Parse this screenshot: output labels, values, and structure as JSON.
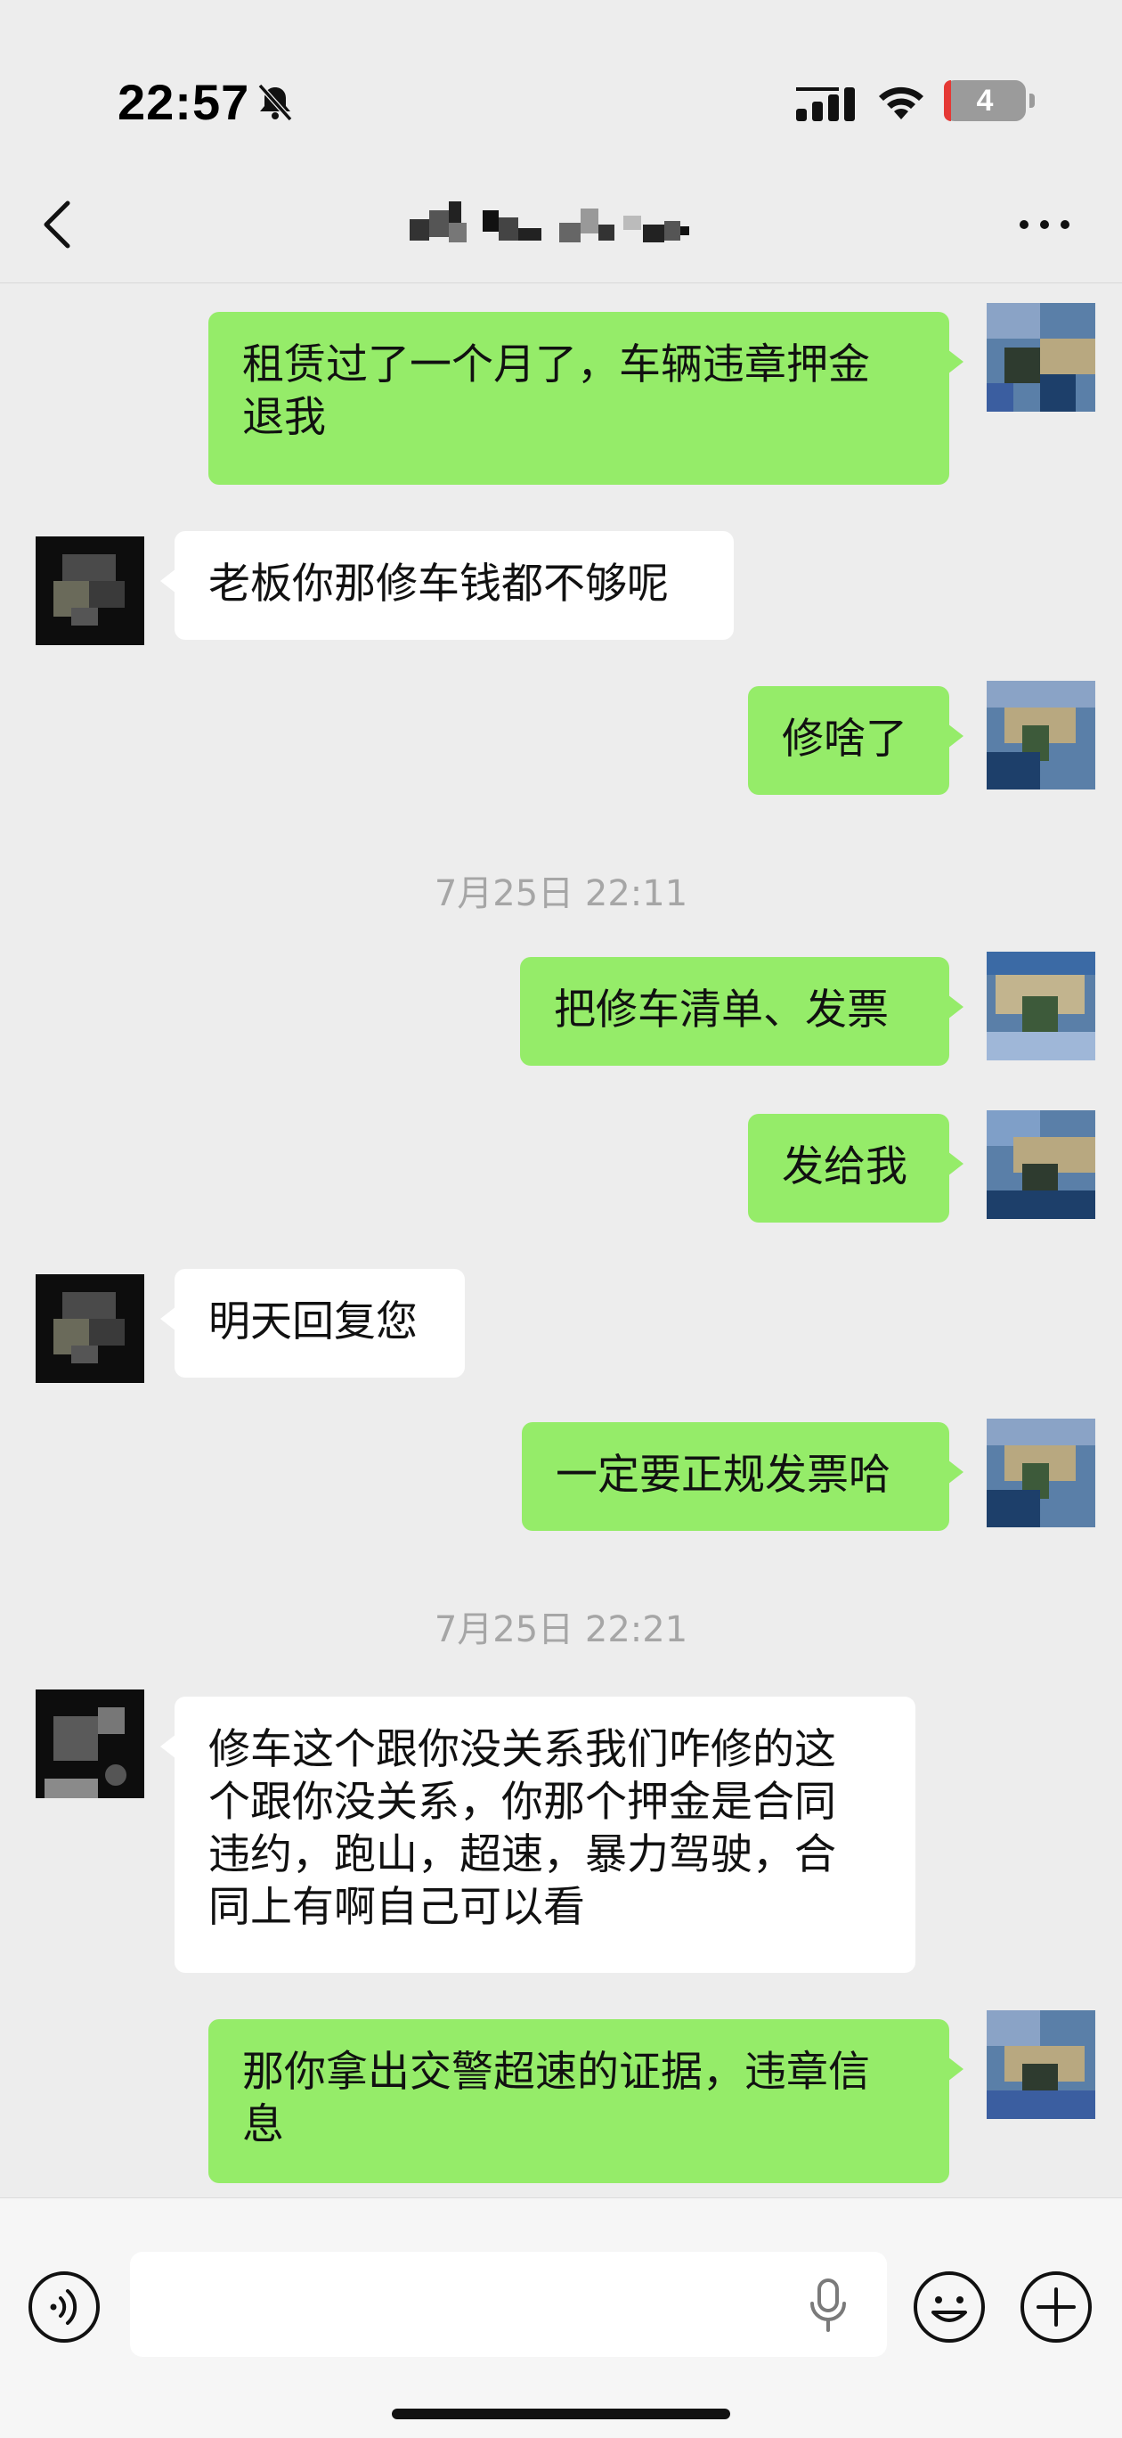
{
  "status_bar": {
    "time": "22:57",
    "battery_level": "4",
    "icons": [
      "bell-off-icon",
      "signal-icon",
      "wifi-icon",
      "battery-icon"
    ]
  },
  "nav": {
    "back_icon": "chevron-left-icon",
    "more_icon": "more-dots-icon"
  },
  "messages": [
    {
      "direction": "out",
      "text": "租赁过了一个月了，车辆违章押金\n退我"
    },
    {
      "direction": "in",
      "text": "老板你那修车钱都不够呢"
    },
    {
      "direction": "out",
      "text": "修啥了"
    },
    {
      "timestamp": "7月25日 22:11"
    },
    {
      "direction": "out",
      "text": "把修车清单、发票"
    },
    {
      "direction": "out",
      "text": "发给我"
    },
    {
      "direction": "in",
      "text": "明天回复您"
    },
    {
      "direction": "out",
      "text": "一定要正规发票哈"
    },
    {
      "timestamp": "7月25日 22:21"
    },
    {
      "direction": "in",
      "text": "修车这个跟你没关系我们咋修的这\n个跟你没关系，你那个押金是合同\n违约，跑山，超速，暴力驾驶，合\n同上有啊自己可以看"
    },
    {
      "direction": "out",
      "text": "那你拿出交警超速的证据，违章信\n息"
    }
  ],
  "input_bar": {
    "icons": [
      "voice-icon",
      "mic-icon",
      "emoji-icon",
      "plus-icon"
    ],
    "input_value": ""
  },
  "colors": {
    "background": "#ededed",
    "outgoing_bubble": "#95ec69",
    "incoming_bubble": "#ffffff",
    "timestamp_text": "#a6a6a6"
  }
}
